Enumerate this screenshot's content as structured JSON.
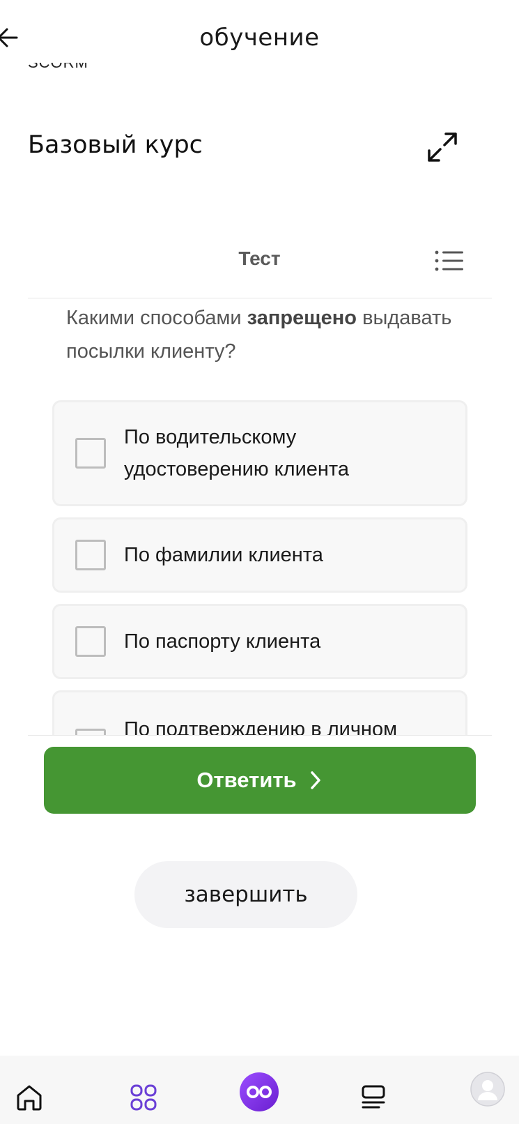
{
  "header": {
    "title": "обучение",
    "back_icon": "arrow-left-icon"
  },
  "scorm_label": "SCORM",
  "course": {
    "title": "Базовый курс",
    "expand_icon": "expand-icon"
  },
  "test": {
    "title": "Тест",
    "menu_icon": "list-icon"
  },
  "question": {
    "text_before": "Какими способами ",
    "text_bold": "запрещено",
    "text_after": " выдавать посылки клиенту?"
  },
  "answers": [
    {
      "label": "По водительскому удостоверению клиента",
      "checked": false
    },
    {
      "label": "По фамилии клиента",
      "checked": false
    },
    {
      "label": "По паспорту клиента",
      "checked": false
    },
    {
      "label": "По подтверждению в личном",
      "checked": false
    }
  ],
  "actions": {
    "submit_label": "Ответить",
    "finish_label": "завершить"
  },
  "bottom_nav": {
    "items": [
      "home-icon",
      "apps-grid-icon",
      "infinity-icon",
      "courses-icon",
      "profile-avatar"
    ]
  },
  "colors": {
    "submit_bg": "#459633",
    "nav_accent": "#6a3fd6",
    "nav_center": "#7b2fe0"
  }
}
